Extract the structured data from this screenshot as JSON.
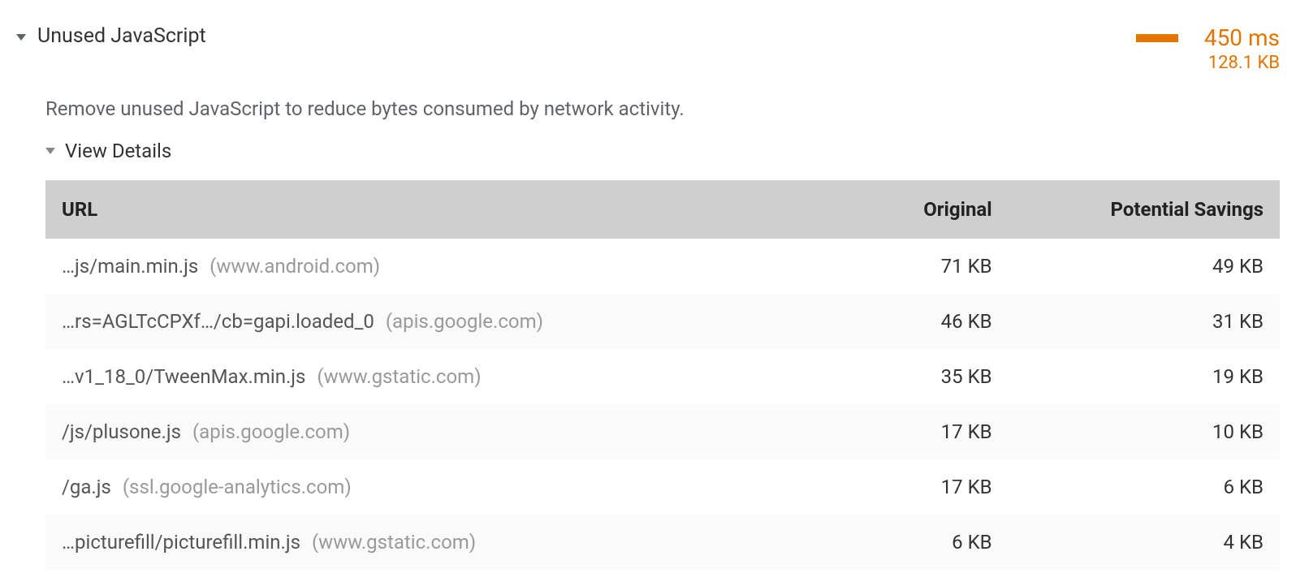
{
  "audit": {
    "title": "Unused JavaScript",
    "description": "Remove unused JavaScript to reduce bytes consumed by network activity.",
    "metric_time": "450 ms",
    "metric_size": "128.1 KB",
    "view_details_label": "View Details",
    "columns": {
      "url": "URL",
      "original": "Original",
      "savings": "Potential Savings"
    },
    "rows": [
      {
        "path": "…js/main.min.js",
        "domain": "(www.android.com)",
        "original": "71 KB",
        "savings": "49 KB"
      },
      {
        "path": "…rs=AGLTcCPXf…/cb=gapi.loaded_0",
        "domain": "(apis.google.com)",
        "original": "46 KB",
        "savings": "31 KB"
      },
      {
        "path": "…v1_18_0/TweenMax.min.js",
        "domain": "(www.gstatic.com)",
        "original": "35 KB",
        "savings": "19 KB"
      },
      {
        "path": "/js/plusone.js",
        "domain": "(apis.google.com)",
        "original": "17 KB",
        "savings": "10 KB"
      },
      {
        "path": "/ga.js",
        "domain": "(ssl.google-analytics.com)",
        "original": "17 KB",
        "savings": "6 KB"
      },
      {
        "path": "…picturefill/picturefill.min.js",
        "domain": "(www.gstatic.com)",
        "original": "6 KB",
        "savings": "4 KB"
      }
    ]
  }
}
